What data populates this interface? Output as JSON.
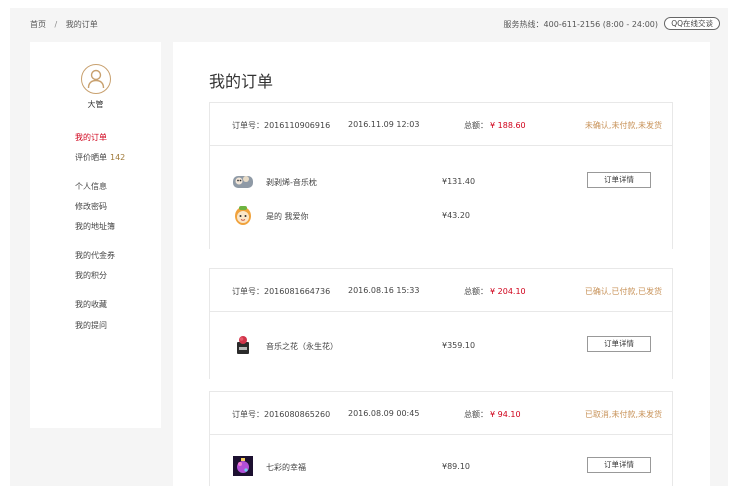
{
  "breadcrumb": {
    "home": "首页",
    "separator": "/",
    "current": "我的订单"
  },
  "hotline": "服务热线：400-611-2156 (8:00 - 24:00)",
  "qq_button": "QQ在线交谈",
  "user": {
    "name": "大管"
  },
  "sidebar": {
    "items": [
      {
        "label": "我的订单"
      },
      {
        "label": "评价晒单",
        "count": "142"
      },
      {
        "label": "个人信息"
      },
      {
        "label": "修改密码"
      },
      {
        "label": "我的地址簿"
      },
      {
        "label": "我的代金券"
      },
      {
        "label": "我的积分"
      },
      {
        "label": "我的收藏"
      },
      {
        "label": "我的提问"
      }
    ]
  },
  "main": {
    "title": "我的订单"
  },
  "orders": [
    {
      "id_label": "订单号：2016110906916",
      "date": "2016.11.09 12:03",
      "total_label": "总额：",
      "total": "¥ 188.60",
      "status": "未确认,未付款,未发货",
      "detail_label": "订单详情",
      "items": [
        {
          "name": "剥剥烯-音乐枕",
          "price": "¥131.40",
          "icon": "pillow-thumb"
        },
        {
          "name": "是的 我爱你",
          "price": "¥43.20",
          "icon": "egg-doll-thumb"
        }
      ]
    },
    {
      "id_label": "订单号：2016081664736",
      "date": "2016.08.16 15:33",
      "total_label": "总额：",
      "total": "¥ 204.10",
      "status": "已确认,已付款,已发货",
      "detail_label": "订单详情",
      "items": [
        {
          "name": "音乐之花（永生花）",
          "price": "¥359.10",
          "icon": "flower-box-thumb"
        }
      ]
    },
    {
      "id_label": "订单号：2016080865260",
      "date": "2016.08.09 00:45",
      "total_label": "总额：",
      "total": "¥ 94.10",
      "status": "已取消,未付款,未发货",
      "detail_label": "订单详情",
      "items": [
        {
          "name": "七彩的幸福",
          "price": "¥89.10",
          "icon": "colorful-gift-thumb"
        }
      ]
    }
  ],
  "colors": {
    "accent_red": "#d0021b",
    "status_gold": "#c8935a",
    "avatar_gold": "#c8a06e",
    "background": "#f5f5f5"
  }
}
